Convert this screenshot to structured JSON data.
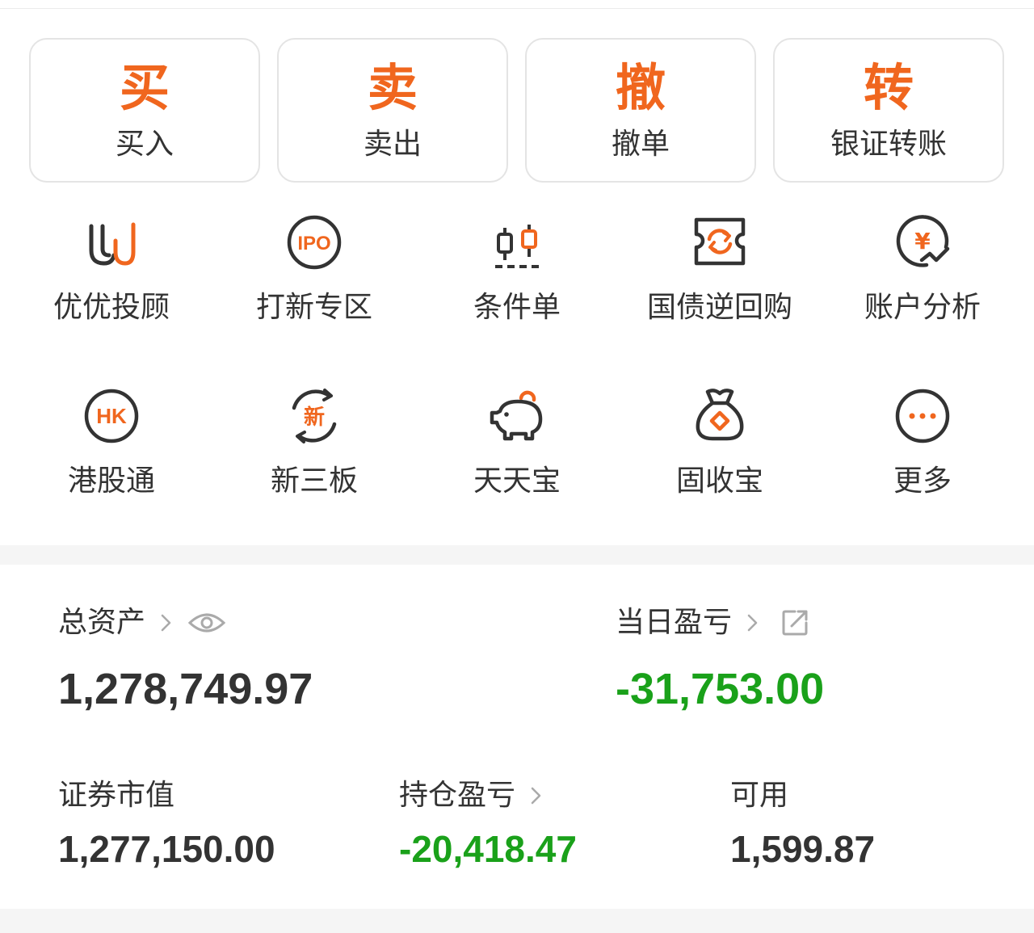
{
  "actions": [
    {
      "big": "买",
      "small": "买入"
    },
    {
      "big": "卖",
      "small": "卖出"
    },
    {
      "big": "撤",
      "small": "撤单"
    },
    {
      "big": "转",
      "small": "银证转账"
    }
  ],
  "grid": [
    {
      "label": "优优投顾",
      "icon": "youyou-advisor-icon"
    },
    {
      "label": "打新专区",
      "icon": "ipo-icon",
      "icon_text": "IPO"
    },
    {
      "label": "条件单",
      "icon": "candlestick-icon"
    },
    {
      "label": "国债逆回购",
      "icon": "repo-ticket-icon"
    },
    {
      "label": "账户分析",
      "icon": "yuan-analysis-icon",
      "icon_text": "¥"
    },
    {
      "label": "港股通",
      "icon": "hk-connect-icon",
      "icon_text": "HK"
    },
    {
      "label": "新三板",
      "icon": "neeq-icon",
      "icon_text": "新"
    },
    {
      "label": "天天宝",
      "icon": "piggy-bank-icon"
    },
    {
      "label": "固收宝",
      "icon": "money-bag-icon"
    },
    {
      "label": "更多",
      "icon": "more-dots-icon"
    }
  ],
  "assets": {
    "total_label": "总资产",
    "total_value": "1,278,749.97",
    "daily_pl_label": "当日盈亏",
    "daily_pl_value": "-31,753.00",
    "market_value_label": "证券市值",
    "market_value": "1,277,150.00",
    "holding_pl_label": "持仓盈亏",
    "holding_pl_value": "-20,418.47",
    "available_label": "可用",
    "available_value": "1,599.87"
  },
  "colors": {
    "accent": "#f0661e",
    "loss_green": "#1aa11a",
    "text": "#333333",
    "muted": "#aaaaaa"
  }
}
